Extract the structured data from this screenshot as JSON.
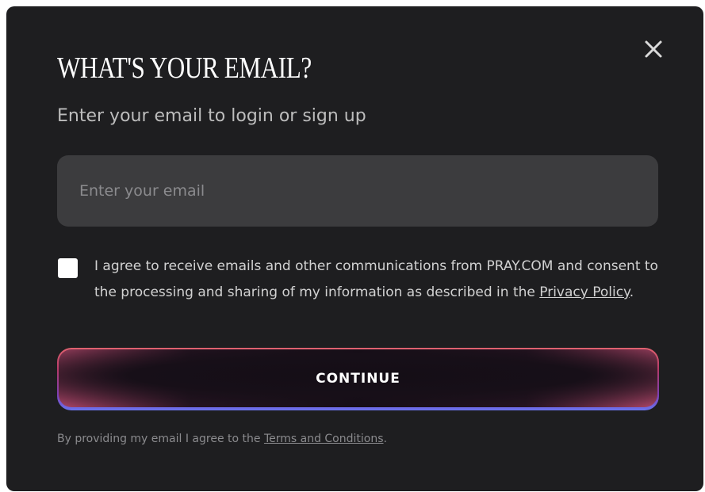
{
  "modal": {
    "title": "WHAT'S YOUR EMAIL?",
    "subtitle": "Enter your email to login or sign up",
    "close_icon": "close-icon",
    "email_input": {
      "placeholder": "Enter your email",
      "value": ""
    },
    "consent": {
      "checked": false,
      "text_before_link": "I agree to receive emails and other communications from PRAY.COM and consent to the processing and sharing of my information as described in the ",
      "link_label": "Privacy Policy",
      "text_after_link": "."
    },
    "continue_label": "CONTINUE",
    "footer": {
      "text_before_link": "By providing my email I agree to the ",
      "link_label": "Terms and Conditions",
      "text_after_link": "."
    }
  },
  "colors": {
    "modal_background": "#1e1e20",
    "input_background": "#3c3c3e",
    "button_gradient_top": "#e0626f",
    "button_gradient_bottom": "#6b73ee"
  }
}
